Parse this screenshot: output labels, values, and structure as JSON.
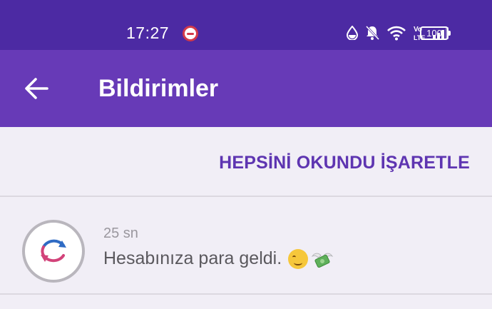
{
  "status_bar": {
    "time": "17:27",
    "battery": "100",
    "network_label": "Vo LTE"
  },
  "app_bar": {
    "title": "Bildirimler",
    "back_icon": "arrow-left-icon"
  },
  "actions": {
    "mark_all_read": "HEPSİNİ OKUNDU İŞARETLE"
  },
  "notifications": [
    {
      "time": "25 sn",
      "message": "Hesabınıza para geldi.",
      "emojis": [
        "smiling-face",
        "money-with-wings"
      ]
    }
  ],
  "colors": {
    "status_bar": "#4c2aa3",
    "app_bar": "#673ab7",
    "accent": "#5e35b1",
    "background": "#f1eef6"
  }
}
